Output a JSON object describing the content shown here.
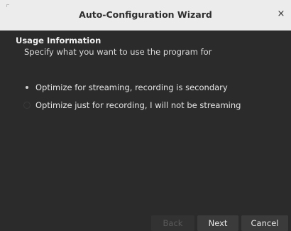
{
  "window": {
    "title": "Auto-Configuration Wizard",
    "close_glyph": "×"
  },
  "page": {
    "section_title": "Usage Information",
    "section_subtitle": "Specify what you want to use the program for"
  },
  "options": [
    {
      "label": "Optimize for streaming, recording is secondary",
      "selected": true
    },
    {
      "label": "Optimize just for recording, I will not be streaming",
      "selected": false
    }
  ],
  "buttons": {
    "back_label": "Back",
    "back_enabled": false,
    "next_label": "Next",
    "cancel_label": "Cancel"
  },
  "colors": {
    "content_bg": "#2b2b2b",
    "titlebar_bg": "#ececec",
    "button_bg": "#3b3b3b",
    "text": "#e6e6e6"
  }
}
